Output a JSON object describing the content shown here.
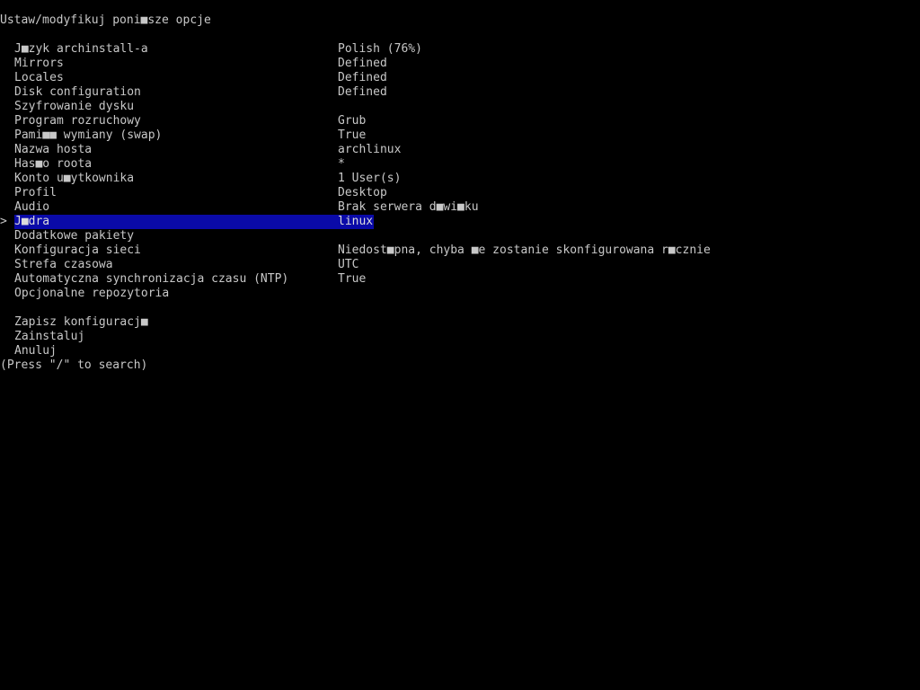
{
  "header": {
    "title": "Ustaw/modyfikuj poni■sze opcje"
  },
  "cursor_symbol": ">",
  "menu": {
    "items": [
      {
        "label": "J■zyk archinstall-a",
        "value": "Polish (76%)"
      },
      {
        "label": "Mirrors",
        "value": "Defined"
      },
      {
        "label": "Locales",
        "value": "Defined"
      },
      {
        "label": "Disk configuration",
        "value": "Defined"
      },
      {
        "label": "Szyfrowanie dysku",
        "value": ""
      },
      {
        "label": "Program rozruchowy",
        "value": "Grub"
      },
      {
        "label": "Pami■■ wymiany (swap)",
        "value": "True"
      },
      {
        "label": "Nazwa hosta",
        "value": "archlinux"
      },
      {
        "label": "Has■o roota",
        "value": "*"
      },
      {
        "label": "Konto u■ytkownika",
        "value": "1 User(s)"
      },
      {
        "label": "Profil",
        "value": "Desktop"
      },
      {
        "label": "Audio",
        "value": "Brak serwera d■wi■ku"
      },
      {
        "label": "J■dra",
        "value": "linux",
        "selected": true
      },
      {
        "label": "Dodatkowe pakiety",
        "value": ""
      },
      {
        "label": "Konfiguracja sieci",
        "value": "Niedost■pna, chyba ■e zostanie skonfigurowana r■cznie"
      },
      {
        "label": "Strefa czasowa",
        "value": "UTC"
      },
      {
        "label": "Automatyczna synchronizacja czasu (NTP)",
        "value": "True"
      },
      {
        "label": "Opcjonalne repozytoria",
        "value": ""
      }
    ],
    "actions": [
      {
        "label": "Zapisz konfiguracj■"
      },
      {
        "label": "Zainstaluj"
      },
      {
        "label": "Anuluj"
      }
    ]
  },
  "footer": {
    "hint": "(Press \"/\" to search)"
  },
  "colors": {
    "background": "#000000",
    "text": "#c8c8c8",
    "selection": "#0a0aa8"
  }
}
